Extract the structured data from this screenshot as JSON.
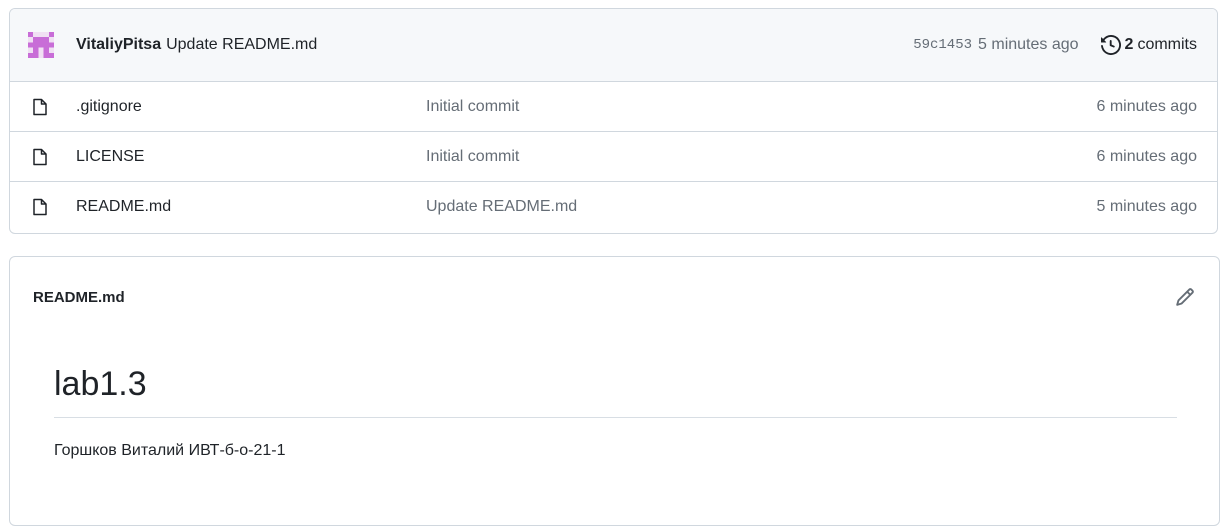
{
  "latest_commit": {
    "author": "VitaliyPitsa",
    "message": "Update README.md",
    "sha": "59c1453",
    "time": "5 minutes ago",
    "commits_count": "2",
    "commits_label": "commits"
  },
  "files": [
    {
      "name": ".gitignore",
      "commit_message": "Initial commit",
      "time": "6 minutes ago",
      "icon": "file-icon"
    },
    {
      "name": "LICENSE",
      "commit_message": "Initial commit",
      "time": "6 minutes ago",
      "icon": "file-icon"
    },
    {
      "name": "README.md",
      "commit_message": "Update README.md",
      "time": "5 minutes ago",
      "icon": "file-icon"
    }
  ],
  "readme": {
    "filename": "README.md",
    "heading": "lab1.3",
    "paragraph": "Горшков Виталий ИВТ-б-о-21-1"
  },
  "colors": {
    "border": "#d0d7de",
    "header_bg": "#f6f8fa",
    "muted_text": "#656d76",
    "avatar": "#c86dd7"
  }
}
